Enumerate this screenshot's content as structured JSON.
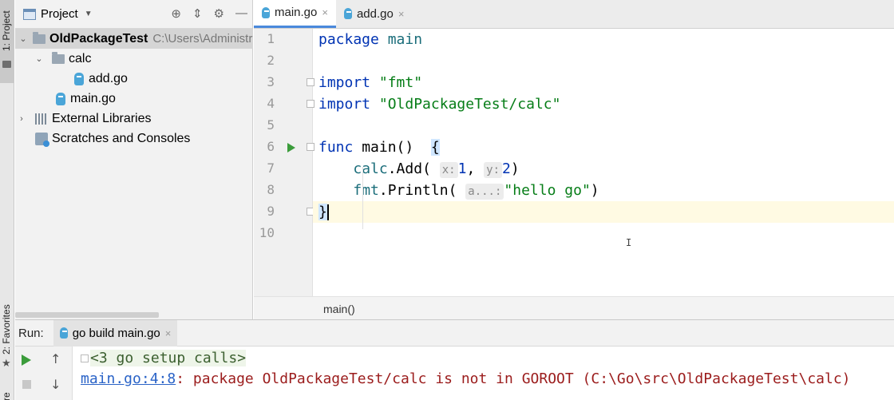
{
  "left_strip": {
    "project_tab": "1: Project",
    "favorites_tab": "2: Favorites",
    "structure_tab": "re"
  },
  "project_panel": {
    "title": "Project",
    "tree": [
      {
        "label": "OldPackageTest",
        "path": "C:\\Users\\Administr",
        "type": "folder",
        "level": 0,
        "expanded": true,
        "selected": true
      },
      {
        "label": "calc",
        "type": "folder",
        "level": 1,
        "expanded": true
      },
      {
        "label": "add.go",
        "type": "gofile",
        "level": 2
      },
      {
        "label": "main.go",
        "type": "gofile",
        "level": 1
      },
      {
        "label": "External Libraries",
        "type": "libraries",
        "level": 0,
        "expanded": false
      },
      {
        "label": "Scratches and Consoles",
        "type": "scratches",
        "level": 0
      }
    ]
  },
  "editor": {
    "tabs": [
      {
        "label": "main.go",
        "active": true,
        "close": "×"
      },
      {
        "label": "add.go",
        "active": false,
        "close": "×"
      }
    ],
    "line_numbers": [
      "1",
      "2",
      "3",
      "4",
      "5",
      "6",
      "7",
      "8",
      "9",
      "10"
    ],
    "code": {
      "l1_kw": "package",
      "l1_name": "main",
      "l3_kw": "import",
      "l3_str": "\"fmt\"",
      "l4_kw": "import",
      "l4_str": "\"OldPackageTest/calc\"",
      "l6_kw": "func",
      "l6_rest": "main()",
      "l6_brace": "{",
      "l7_pkg": "calc",
      "l7_call": ".Add(",
      "l7_hint_x": "x:",
      "l7_arg1": "1",
      "l7_comma": ",",
      "l7_hint_y": "y:",
      "l7_arg2": "2",
      "l7_close": ")",
      "l8_pkg": "fmt",
      "l8_call": ".Println(",
      "l8_hint": "a...:",
      "l8_str": "\"hello go\"",
      "l8_close": ")",
      "l9_brace": "}"
    },
    "current_line": 9,
    "breadcrumb": "main()"
  },
  "run_panel": {
    "label": "Run:",
    "tab": "go build main.go",
    "tab_close": "×",
    "console": {
      "setup": "<3 go setup calls>",
      "error_link": "main.go:4:8",
      "error_text": ": package OldPackageTest/calc is not in GOROOT (C:\\Go\\src\\OldPackageTest\\calc)"
    }
  },
  "colors": {
    "keyword": "#0033b3",
    "string": "#067d17",
    "error": "#9b1c1c",
    "link": "#2a63c7",
    "run_green": "#3b9c3b",
    "current_line": "#fffae3"
  }
}
